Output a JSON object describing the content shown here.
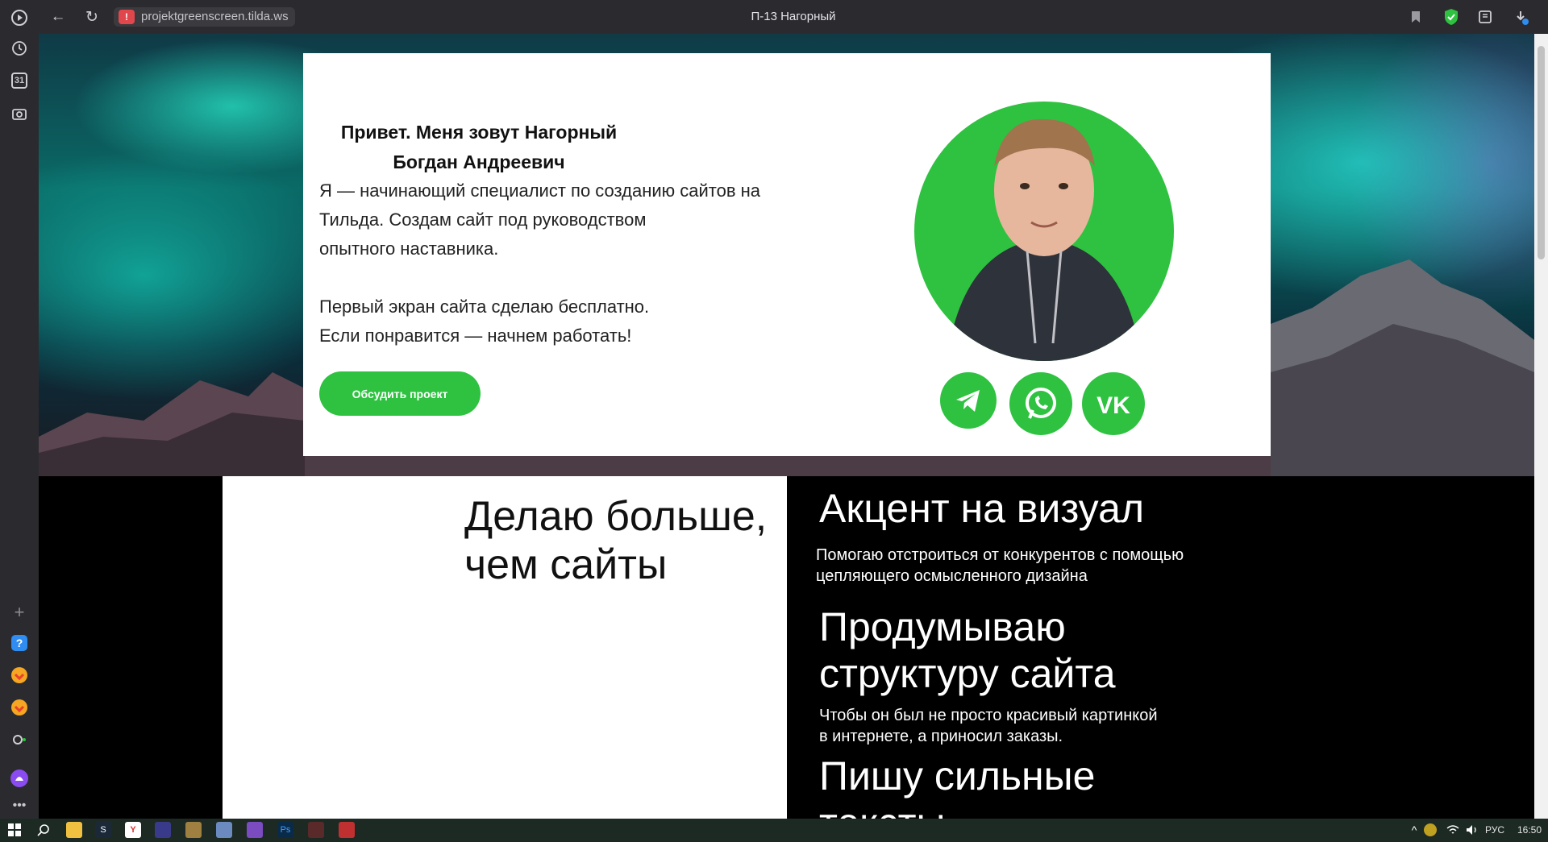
{
  "browser": {
    "url": "projektgreenscreen.tilda.ws",
    "page_title": "П-13 Нагорный"
  },
  "sidebar": {
    "calendar_day": "31"
  },
  "hero": {
    "greeting_line1": "Привет. Меня зовут Нагорный",
    "greeting_line2": "Богдан Андреевич",
    "intro_line1": "Я — начинающий специалист по созданию сайтов на",
    "intro_line2": "Тильда. Создам сайт под руководством",
    "intro_line3": "опытного наставника.",
    "offer_line1": "Первый экран сайта сделаю бесплатно.",
    "offer_line2": "Если понравится — начнем работать!",
    "cta_label": "Обсудить проект"
  },
  "section": {
    "heading_line1": "Делаю больше,",
    "heading_line2": "чем сайты",
    "features": [
      {
        "title": "Акцент на визуал",
        "desc_line1": "Помогаю отстроиться от конкурентов с помощью",
        "desc_line2": "цепляющего осмысленного дизайна"
      },
      {
        "title_line1": "Продумываю",
        "title_line2": "структуру сайта",
        "desc_line1": "Чтобы он был не просто красивый картинкой",
        "desc_line2": "в интернете, а приносил заказы."
      },
      {
        "title_line1": "Пишу сильные",
        "title_line2": "тексты"
      }
    ]
  },
  "taskbar": {
    "language": "РУС",
    "time": "16:50"
  },
  "colors": {
    "accent_green": "#2ec240",
    "chrome": "#2b2b2f"
  }
}
